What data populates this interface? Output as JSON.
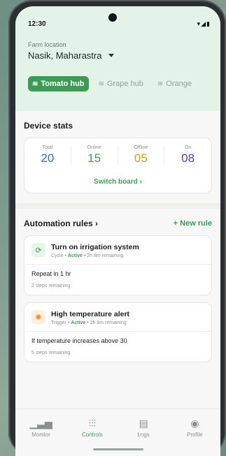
{
  "status": {
    "time": "12:30",
    "icons": "▾◢▮"
  },
  "farm": {
    "label": "Farm location",
    "name": "Nasik, Maharastra"
  },
  "hubs": [
    {
      "label": "Tomato hub",
      "active": true
    },
    {
      "label": "Grape hub",
      "active": false
    },
    {
      "label": "Orange",
      "active": false
    }
  ],
  "stats": {
    "title": "Device stats",
    "items": [
      {
        "label": "Total",
        "value": "20",
        "color": "#2f6fb3"
      },
      {
        "label": "Online",
        "value": "15",
        "color": "#3f9a56"
      },
      {
        "label": "Offline",
        "value": "05",
        "color": "#e09a2a"
      },
      {
        "label": "On",
        "value": "08",
        "color": "#5b3fa8"
      }
    ],
    "switch_label": "Switch board  ›"
  },
  "automation": {
    "title": "Automation rules  ›",
    "new_rule": "+ New rule",
    "rules": [
      {
        "title": "Turn on irrigation system",
        "type": "Cycle",
        "status": "Active",
        "remaining": "2h 8m remaining",
        "condition": "Repeat in 1 hr",
        "steps": "2 steps remaining",
        "icon": "cycle-icon"
      },
      {
        "title": "High temperature alert",
        "type": "Trigger",
        "status": "Active",
        "remaining": "2h 8m remaining",
        "condition": "If temperature increases above 30",
        "steps": "5 steps remaining",
        "icon": "sun-icon"
      }
    ]
  },
  "nav": [
    {
      "label": "Monitor",
      "icon": "chart-icon",
      "active": false
    },
    {
      "label": "Controls",
      "icon": "sliders-icon",
      "active": true
    },
    {
      "label": "Logs",
      "icon": "logs-icon",
      "active": false
    },
    {
      "label": "Profile",
      "icon": "profile-icon",
      "active": false
    }
  ],
  "colors": {
    "accent": "#3f9a56",
    "header_bg": "#e4f3e7"
  }
}
